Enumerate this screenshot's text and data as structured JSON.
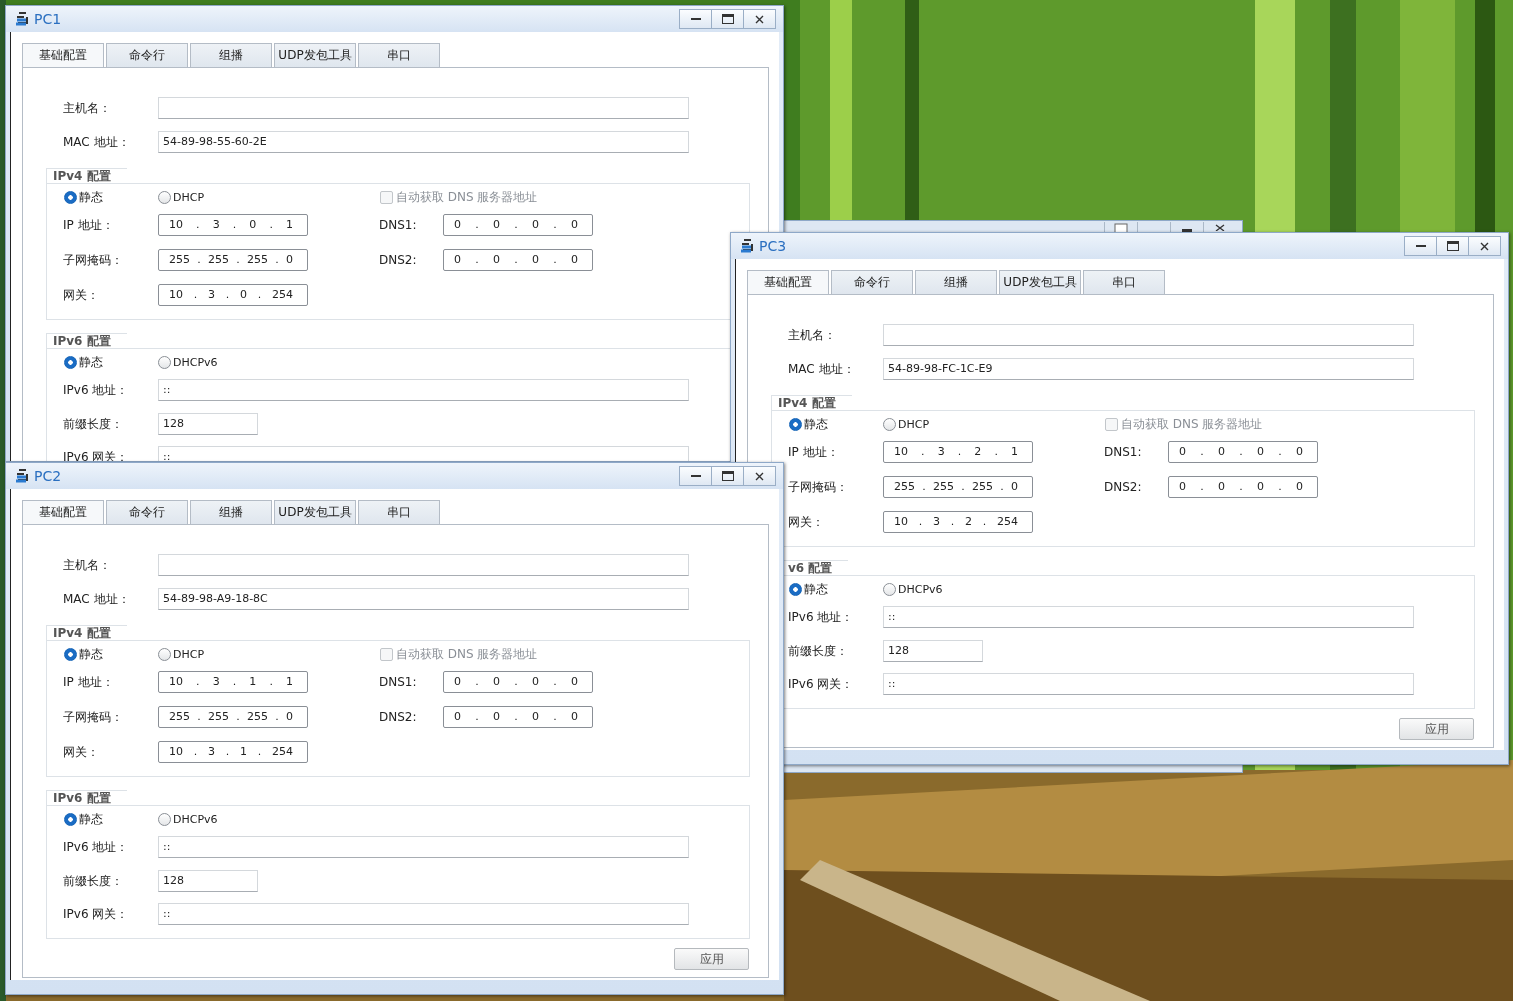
{
  "windows": [
    {
      "title": "PC1",
      "tabs": [
        {
          "label": "基础配置",
          "selected": true
        },
        {
          "label": "命令行",
          "selected": false
        },
        {
          "label": "组播",
          "selected": false
        },
        {
          "label": "UDP发包工具",
          "selected": false
        },
        {
          "label": "串口",
          "selected": false
        }
      ],
      "host_name": {
        "label": "主机名："
      },
      "mac": {
        "label": "MAC 地址：",
        "value": "54-89-98-55-60-2E"
      },
      "ipv4": {
        "title": "IPv4 配置",
        "modes": [
          {
            "label": "静态",
            "selected": true
          },
          {
            "label": "DHCP",
            "selected": false
          }
        ],
        "auto_dns": {
          "label": "自动获取 DNS 服务器地址",
          "checked": false,
          "disabled": true
        },
        "ip": {
          "label": "IP 地址：",
          "value": "10 . 3 . 0 . 1"
        },
        "mask": {
          "label": "子网掩码：",
          "value": "255 . 255 . 255 . 0"
        },
        "gateway": {
          "label": "网关：",
          "value": "10 . 3 . 0 . 254"
        },
        "dns1": {
          "label": "DNS1:",
          "value": "0 . 0 . 0 . 0"
        },
        "dns2": {
          "label": "DNS2:",
          "value": "0 . 0 . 0 . 0"
        }
      },
      "ipv6": {
        "title": "IPv6 配置",
        "modes": [
          {
            "label": "静态",
            "selected": true
          },
          {
            "label": "DHCPv6",
            "selected": false
          }
        ],
        "address": {
          "label": "IPv6 地址：",
          "value": "::"
        },
        "prefix": {
          "label": "前缀长度：",
          "value": "128"
        },
        "gateway": {
          "label": "IPv6 网关：",
          "value": "::"
        }
      }
    },
    {
      "title": "PC3",
      "tabs": [
        {
          "label": "基础配置",
          "selected": true
        },
        {
          "label": "命令行",
          "selected": false
        },
        {
          "label": "组播",
          "selected": false
        },
        {
          "label": "UDP发包工具",
          "selected": false
        },
        {
          "label": "串口",
          "selected": false
        }
      ],
      "host_name": {
        "label": "主机名："
      },
      "mac": {
        "label": "MAC 地址：",
        "value": "54-89-98-FC-1C-E9"
      },
      "ipv4": {
        "title": "IPv4 配置",
        "modes": [
          {
            "label": "静态",
            "selected": true
          },
          {
            "label": "DHCP",
            "selected": false
          }
        ],
        "auto_dns": {
          "label": "自动获取 DNS 服务器地址",
          "checked": false,
          "disabled": true
        },
        "ip": {
          "label": "IP 地址：",
          "value": "10 . 3 . 2 . 1"
        },
        "mask": {
          "label": "子网掩码：",
          "value": "255 . 255 . 255 . 0"
        },
        "gateway": {
          "label": "网关：",
          "value": "10 . 3 . 2 . 254"
        },
        "dns1": {
          "label": "DNS1:",
          "value": "0 . 0 . 0 . 0"
        },
        "dns2": {
          "label": "DNS2:",
          "value": "0 . 0 . 0 . 0"
        }
      },
      "ipv6": {
        "title": "v6 配置",
        "modes": [
          {
            "label": "静态",
            "selected": true
          },
          {
            "label": "DHCPv6",
            "selected": false
          }
        ],
        "address": {
          "label": "IPv6 地址：",
          "value": "::"
        },
        "prefix": {
          "label": "前缀长度：",
          "value": "128"
        },
        "gateway": {
          "label": "IPv6 网关：",
          "value": "::"
        }
      },
      "apply_button": "应用"
    },
    {
      "title": "PC2",
      "tabs": [
        {
          "label": "基础配置",
          "selected": true
        },
        {
          "label": "命令行",
          "selected": false
        },
        {
          "label": "组播",
          "selected": false
        },
        {
          "label": "UDP发包工具",
          "selected": false
        },
        {
          "label": "串口",
          "selected": false
        }
      ],
      "host_name": {
        "label": "主机名："
      },
      "mac": {
        "label": "MAC 地址：",
        "value": "54-89-98-A9-18-8C"
      },
      "ipv4": {
        "title": "IPv4 配置",
        "modes": [
          {
            "label": "静态",
            "selected": true
          },
          {
            "label": "DHCP",
            "selected": false
          }
        ],
        "auto_dns": {
          "label": "自动获取 DNS 服务器地址",
          "checked": false,
          "disabled": true
        },
        "ip": {
          "label": "IP 地址：",
          "value": "10 . 3 . 1 . 1"
        },
        "mask": {
          "label": "子网掩码：",
          "value": "255 . 255 . 255 . 0"
        },
        "gateway": {
          "label": "网关：",
          "value": "10 . 3 . 1 . 254"
        },
        "dns1": {
          "label": "DNS1:",
          "value": "0 . 0 . 0 . 0"
        },
        "dns2": {
          "label": "DNS2:",
          "value": "0 . 0 . 0 . 0"
        }
      },
      "ipv6": {
        "title": "IPv6 配置",
        "modes": [
          {
            "label": "静态",
            "selected": true
          },
          {
            "label": "DHCPv6",
            "selected": false
          }
        ],
        "address": {
          "label": "IPv6 地址：",
          "value": "::"
        },
        "prefix": {
          "label": "前缀长度：",
          "value": "128"
        },
        "gateway": {
          "label": "IPv6 网关：",
          "value": "::"
        }
      },
      "apply_button": "应用"
    }
  ]
}
